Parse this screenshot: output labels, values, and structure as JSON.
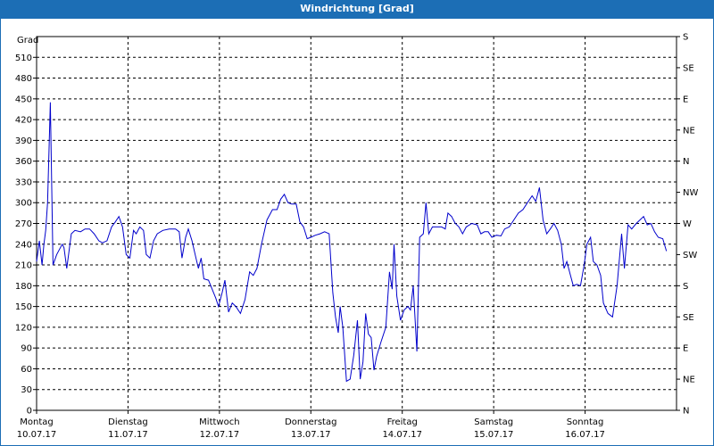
{
  "window": {
    "title": "Windrichtung [Grad]"
  },
  "chart_data": {
    "type": "line",
    "title": "Windrichtung [Grad]",
    "ylabel": "Grad",
    "ylim": [
      0,
      540
    ],
    "y_ticks": [
      0,
      30,
      60,
      90,
      120,
      150,
      180,
      210,
      240,
      270,
      300,
      330,
      360,
      390,
      420,
      450,
      480,
      510
    ],
    "y_ticks_right": [
      "N",
      "NE",
      "E",
      "SE",
      "S",
      "SW",
      "W",
      "NW",
      "N",
      "NE",
      "E",
      "SE",
      "S"
    ],
    "y_ticks_right_values": [
      0,
      45,
      90,
      135,
      180,
      225,
      270,
      315,
      360,
      405,
      450,
      495,
      540
    ],
    "x_range_days": [
      0,
      7
    ],
    "x_ticks": [
      {
        "day": "Montag",
        "date": "10.07.17"
      },
      {
        "day": "Dienstag",
        "date": "11.07.17"
      },
      {
        "day": "Mittwoch",
        "date": "12.07.17"
      },
      {
        "day": "Donnerstag",
        "date": "13.07.17"
      },
      {
        "day": "Freitag",
        "date": "14.07.17"
      },
      {
        "day": "Samstag",
        "date": "15.07.17"
      },
      {
        "day": "Sonntag",
        "date": "16.07.17"
      }
    ],
    "grid": true,
    "line_color": "#0000cc",
    "series": [
      {
        "name": "",
        "points": [
          [
            0.0,
            215
          ],
          [
            0.03,
            245
          ],
          [
            0.06,
            210
          ],
          [
            0.08,
            240
          ],
          [
            0.1,
            260
          ],
          [
            0.12,
            300
          ],
          [
            0.15,
            445
          ],
          [
            0.18,
            210
          ],
          [
            0.22,
            225
          ],
          [
            0.28,
            240
          ],
          [
            0.3,
            235
          ],
          [
            0.33,
            205
          ],
          [
            0.38,
            255
          ],
          [
            0.42,
            260
          ],
          [
            0.48,
            258
          ],
          [
            0.53,
            262
          ],
          [
            0.58,
            262
          ],
          [
            0.63,
            255
          ],
          [
            0.68,
            245
          ],
          [
            0.72,
            242
          ],
          [
            0.77,
            245
          ],
          [
            0.82,
            265
          ],
          [
            0.86,
            272
          ],
          [
            0.9,
            280
          ],
          [
            0.94,
            265
          ],
          [
            0.98,
            225
          ],
          [
            1.02,
            220
          ],
          [
            1.06,
            260
          ],
          [
            1.09,
            255
          ],
          [
            1.13,
            265
          ],
          [
            1.17,
            260
          ],
          [
            1.2,
            225
          ],
          [
            1.24,
            220
          ],
          [
            1.28,
            245
          ],
          [
            1.32,
            255
          ],
          [
            1.38,
            260
          ],
          [
            1.45,
            262
          ],
          [
            1.52,
            262
          ],
          [
            1.56,
            258
          ],
          [
            1.59,
            220
          ],
          [
            1.63,
            250
          ],
          [
            1.66,
            262
          ],
          [
            1.7,
            245
          ],
          [
            1.74,
            222
          ],
          [
            1.77,
            205
          ],
          [
            1.8,
            220
          ],
          [
            1.83,
            190
          ],
          [
            1.88,
            188
          ],
          [
            1.92,
            175
          ],
          [
            1.96,
            162
          ],
          [
            1.99,
            150
          ],
          [
            2.03,
            170
          ],
          [
            2.06,
            188
          ],
          [
            2.1,
            142
          ],
          [
            2.14,
            155
          ],
          [
            2.18,
            150
          ],
          [
            2.23,
            140
          ],
          [
            2.28,
            160
          ],
          [
            2.33,
            200
          ],
          [
            2.37,
            195
          ],
          [
            2.41,
            205
          ],
          [
            2.46,
            240
          ],
          [
            2.52,
            275
          ],
          [
            2.58,
            290
          ],
          [
            2.63,
            290
          ],
          [
            2.67,
            305
          ],
          [
            2.71,
            312
          ],
          [
            2.75,
            300
          ],
          [
            2.79,
            298
          ],
          [
            2.84,
            298
          ],
          [
            2.88,
            272
          ],
          [
            2.92,
            265
          ],
          [
            2.96,
            248
          ],
          [
            3.0,
            250
          ],
          [
            3.05,
            253
          ],
          [
            3.1,
            255
          ],
          [
            3.15,
            258
          ],
          [
            3.2,
            255
          ],
          [
            3.24,
            170
          ],
          [
            3.27,
            135
          ],
          [
            3.3,
            112
          ],
          [
            3.32,
            150
          ],
          [
            3.35,
            120
          ],
          [
            3.39,
            42
          ],
          [
            3.43,
            45
          ],
          [
            3.47,
            80
          ],
          [
            3.51,
            130
          ],
          [
            3.54,
            45
          ],
          [
            3.57,
            70
          ],
          [
            3.6,
            140
          ],
          [
            3.63,
            110
          ],
          [
            3.66,
            105
          ],
          [
            3.69,
            58
          ],
          [
            3.72,
            78
          ],
          [
            3.77,
            100
          ],
          [
            3.82,
            120
          ],
          [
            3.86,
            200
          ],
          [
            3.89,
            175
          ],
          [
            3.91,
            240
          ],
          [
            3.94,
            165
          ],
          [
            3.98,
            130
          ],
          [
            4.02,
            145
          ],
          [
            4.06,
            150
          ],
          [
            4.09,
            145
          ],
          [
            4.12,
            180
          ],
          [
            4.16,
            85
          ],
          [
            4.19,
            250
          ],
          [
            4.23,
            255
          ],
          [
            4.26,
            300
          ],
          [
            4.29,
            255
          ],
          [
            4.33,
            265
          ],
          [
            4.38,
            265
          ],
          [
            4.43,
            265
          ],
          [
            4.47,
            262
          ],
          [
            4.5,
            285
          ],
          [
            4.54,
            280
          ],
          [
            4.58,
            270
          ],
          [
            4.62,
            265
          ],
          [
            4.66,
            255
          ],
          [
            4.7,
            265
          ],
          [
            4.76,
            270
          ],
          [
            4.82,
            268
          ],
          [
            4.86,
            255
          ],
          [
            4.9,
            258
          ],
          [
            4.94,
            258
          ],
          [
            4.98,
            250
          ],
          [
            5.03,
            253
          ],
          [
            5.08,
            252
          ],
          [
            5.12,
            262
          ],
          [
            5.17,
            265
          ],
          [
            5.22,
            275
          ],
          [
            5.27,
            285
          ],
          [
            5.32,
            290
          ],
          [
            5.37,
            300
          ],
          [
            5.42,
            310
          ],
          [
            5.46,
            302
          ],
          [
            5.5,
            322
          ],
          [
            5.54,
            275
          ],
          [
            5.58,
            255
          ],
          [
            5.62,
            262
          ],
          [
            5.66,
            270
          ],
          [
            5.7,
            260
          ],
          [
            5.74,
            240
          ],
          [
            5.77,
            205
          ],
          [
            5.8,
            215
          ],
          [
            5.84,
            195
          ],
          [
            5.87,
            180
          ],
          [
            5.91,
            182
          ],
          [
            5.95,
            180
          ],
          [
            5.99,
            210
          ],
          [
            6.02,
            240
          ],
          [
            6.06,
            250
          ],
          [
            6.09,
            215
          ],
          [
            6.13,
            210
          ],
          [
            6.17,
            195
          ],
          [
            6.2,
            155
          ],
          [
            6.25,
            140
          ],
          [
            6.3,
            135
          ],
          [
            6.35,
            180
          ],
          [
            6.4,
            255
          ],
          [
            6.43,
            205
          ],
          [
            6.47,
            268
          ],
          [
            6.51,
            262
          ],
          [
            6.56,
            270
          ],
          [
            6.6,
            275
          ],
          [
            6.64,
            280
          ],
          [
            6.68,
            268
          ],
          [
            6.72,
            270
          ],
          [
            6.76,
            258
          ],
          [
            6.8,
            250
          ],
          [
            6.85,
            248
          ],
          [
            6.89,
            230
          ]
        ]
      }
    ]
  }
}
